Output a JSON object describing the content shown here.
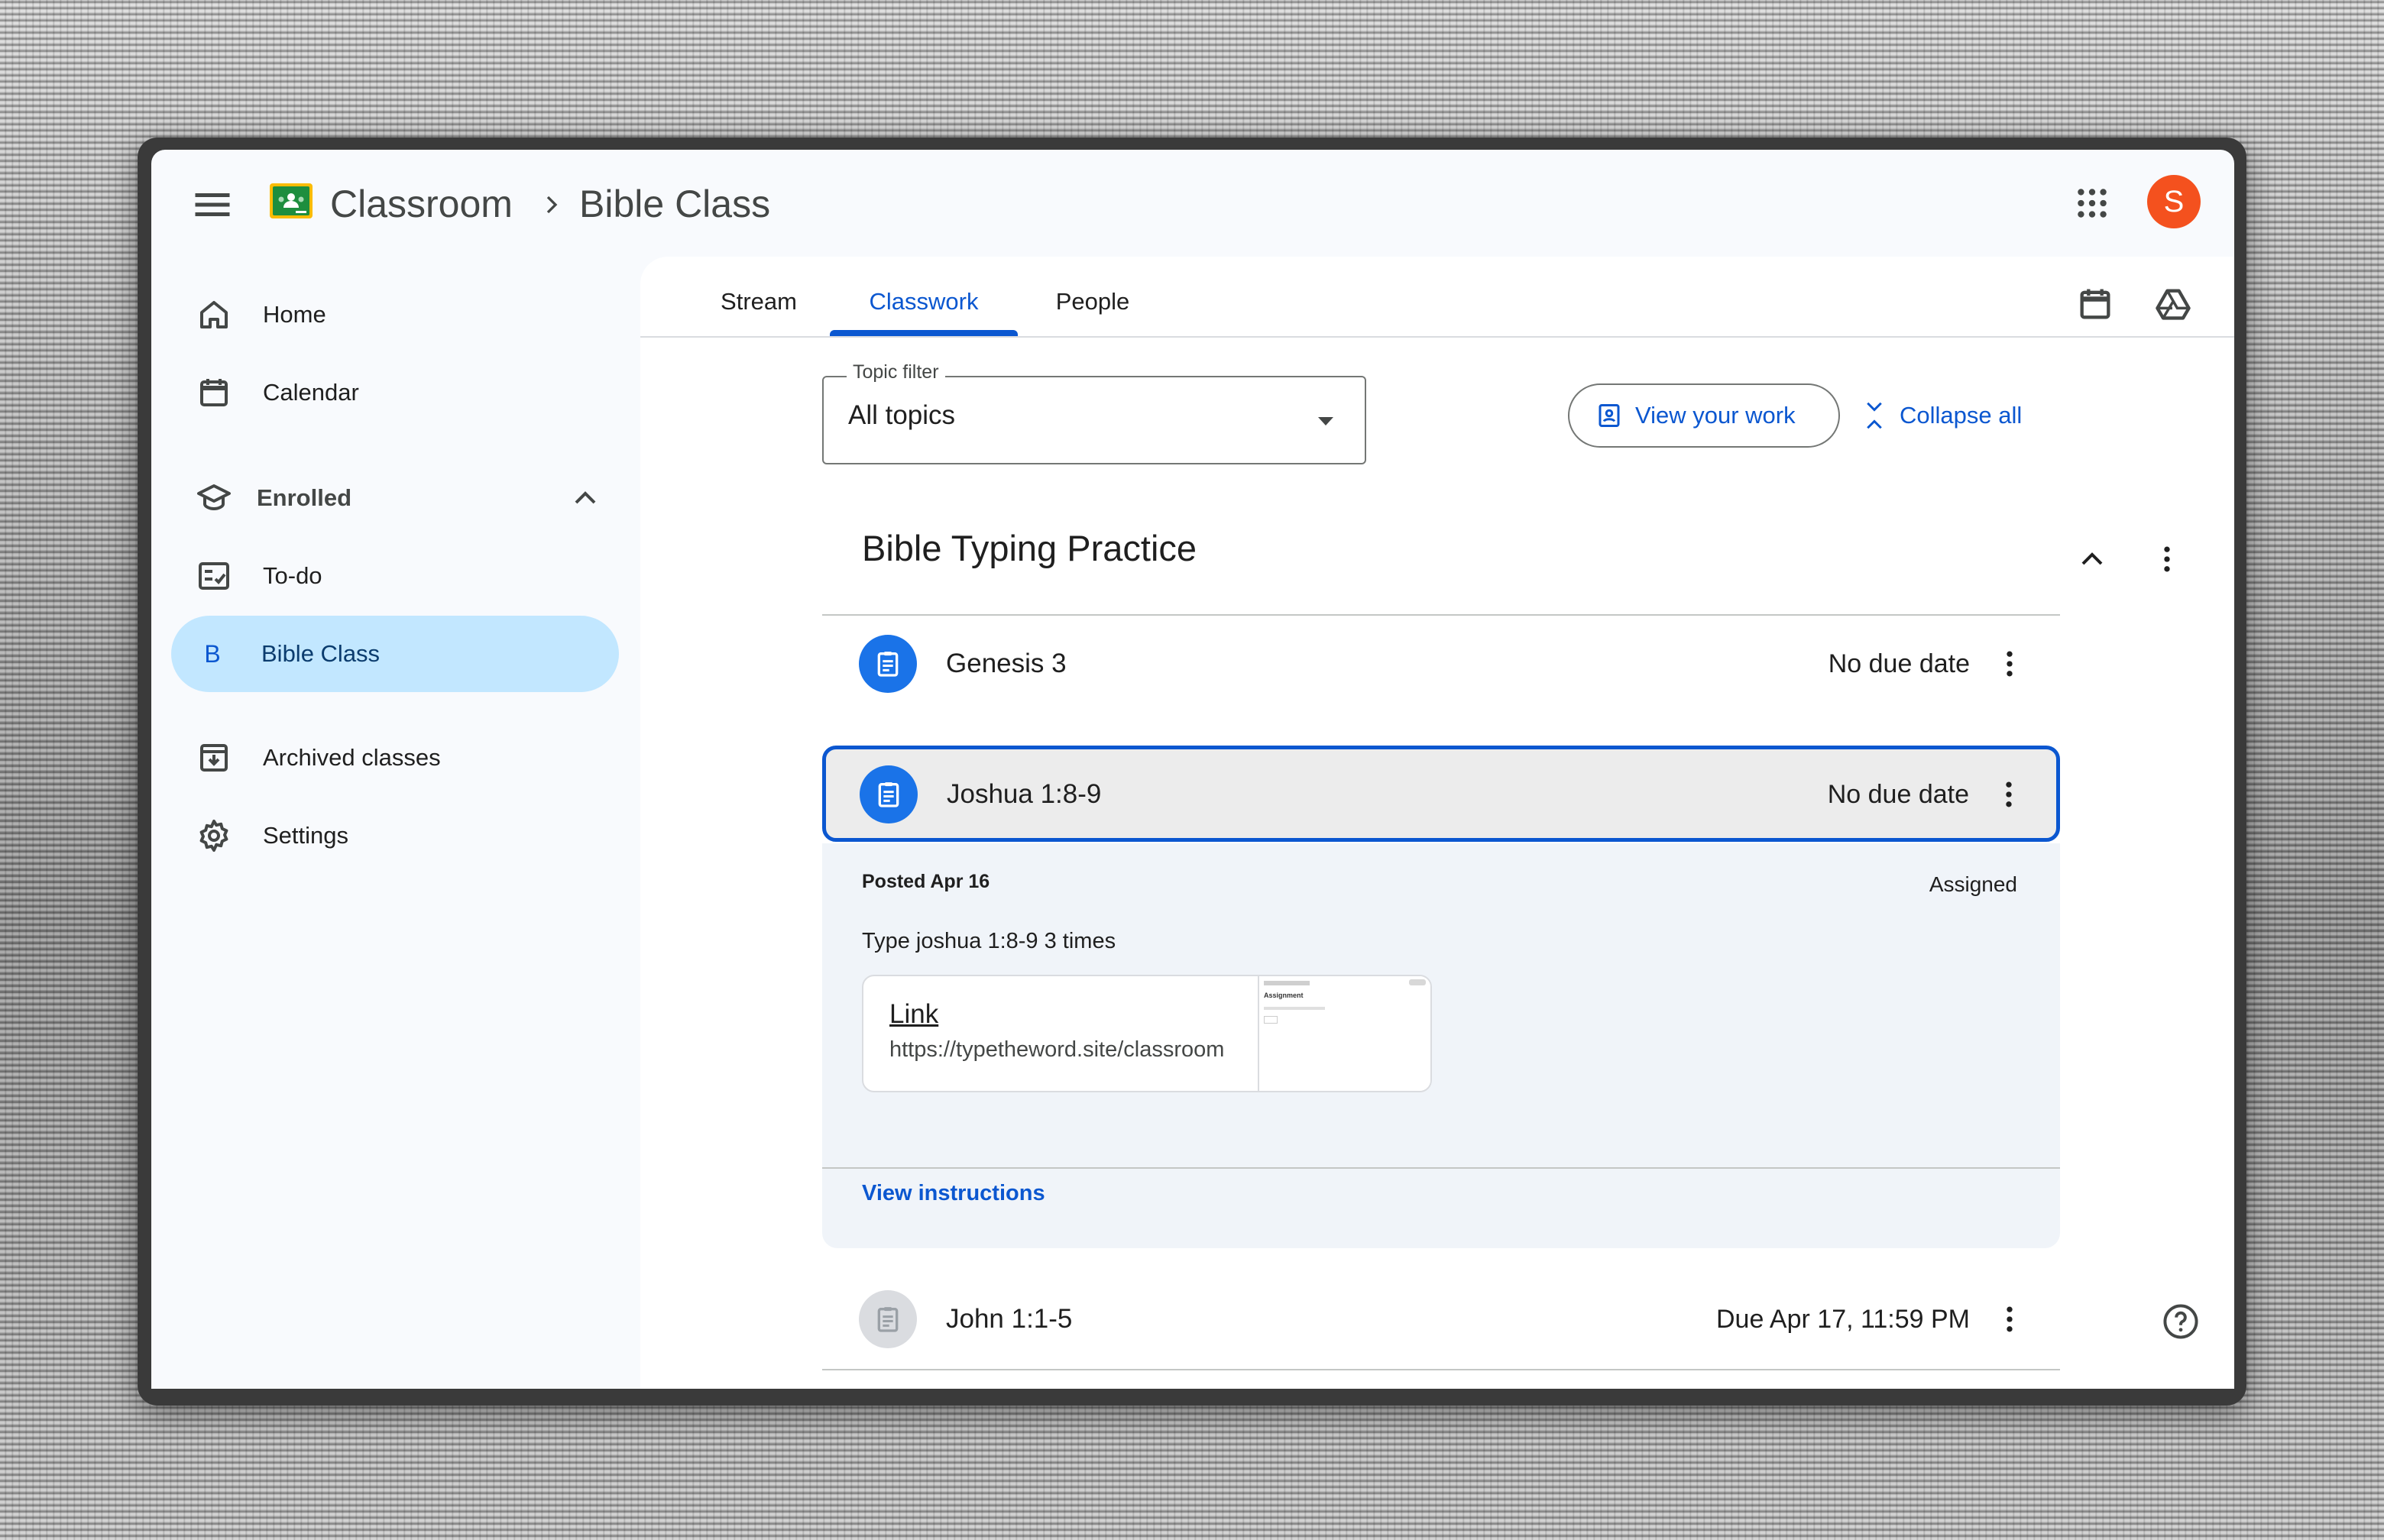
{
  "header": {
    "app_name": "Classroom",
    "breadcrumb": "Bible Class",
    "avatar_letter": "S",
    "avatar_color": "#f4511e"
  },
  "sidebar": {
    "items": [
      {
        "label": "Home",
        "icon": "home-icon"
      },
      {
        "label": "Calendar",
        "icon": "calendar-icon"
      },
      {
        "label": "Enrolled",
        "icon": "enrolled-icon"
      },
      {
        "label": "To-do",
        "icon": "todo-icon"
      },
      {
        "label": "Bible Class",
        "icon": "class-badge",
        "badge": "B",
        "active": true
      },
      {
        "label": "Archived classes",
        "icon": "archive-icon"
      },
      {
        "label": "Settings",
        "icon": "gear-icon"
      }
    ]
  },
  "tabs": [
    {
      "label": "Stream"
    },
    {
      "label": "Classwork",
      "active": true
    },
    {
      "label": "People"
    }
  ],
  "toolbar": {
    "topic_filter_label": "Topic filter",
    "topic_filter_value": "All topics",
    "view_work_label": "View your work",
    "collapse_all_label": "Collapse all"
  },
  "topic": {
    "title": "Bible Typing Practice",
    "assignments": [
      {
        "title": "Genesis 3",
        "due": "No due date"
      },
      {
        "title": "Joshua 1:8-9",
        "due": "No due date",
        "selected": true
      },
      {
        "title": "John 1:1-5",
        "due": "Due Apr 17, 11:59 PM"
      }
    ]
  },
  "detail": {
    "posted": "Posted Apr 16",
    "status": "Assigned",
    "instructions": "Type joshua 1:8-9 3 times",
    "attachment_title": "Link",
    "attachment_url": "https://typetheword.site/classroom",
    "thumb_text": "Assignment",
    "view_instructions_label": "View instructions"
  },
  "colors": {
    "accent": "#0b57d0",
    "active_nav": "#c2e7ff",
    "assignment_icon": "#1a73e8"
  }
}
